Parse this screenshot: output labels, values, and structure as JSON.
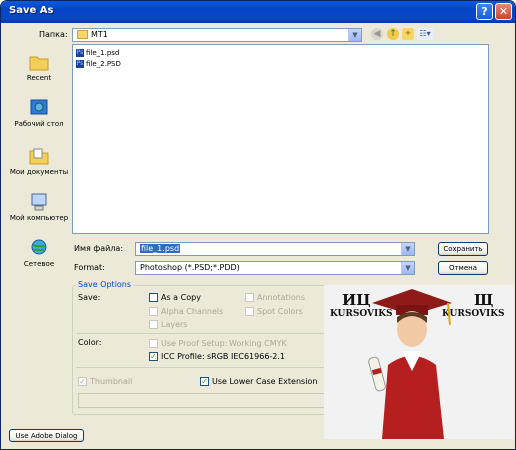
{
  "window": {
    "title": "Save As"
  },
  "toolbar": {
    "folder_label": "Папка:",
    "folder_value": "MT1"
  },
  "places": [
    {
      "label": "Recent"
    },
    {
      "label": "Рабочий стол"
    },
    {
      "label": "Мои документы"
    },
    {
      "label": "Мой компьютер"
    },
    {
      "label": "Сетевое"
    }
  ],
  "files": [
    "file_1.psd",
    "file_2.PSD"
  ],
  "filename": {
    "label": "Имя файла:",
    "value": "file_1.psd"
  },
  "format": {
    "label": "Format:",
    "value": "Photoshop (*.PSD;*.PDD)"
  },
  "buttons": {
    "save": "Сохранить",
    "cancel": "Отмена",
    "adobe_dialog": "Use Adobe Dialog"
  },
  "save_options": {
    "title": "Save Options",
    "save_label": "Save:",
    "as_a_copy": "As a Copy",
    "annotations": "Annotations",
    "alpha_channels": "Alpha Channels",
    "spot_colors": "Spot Colors",
    "layers": "Layers",
    "color_label": "Color:",
    "use_proof_setup": "Use Proof Setup:",
    "working_cmyk": "Working CMYK",
    "icc_profile": "ICC Profile:",
    "icc_value": "sRGB IEC61966-2.1",
    "thumbnail": "Thumbnail",
    "lower_case": "Use Lower Case Extension"
  },
  "watermark": {
    "left_logo": "ИЦ",
    "left_name": "KURSOVIKS",
    "right_logo": "Щ",
    "right_name": "KURSOVIKS"
  }
}
